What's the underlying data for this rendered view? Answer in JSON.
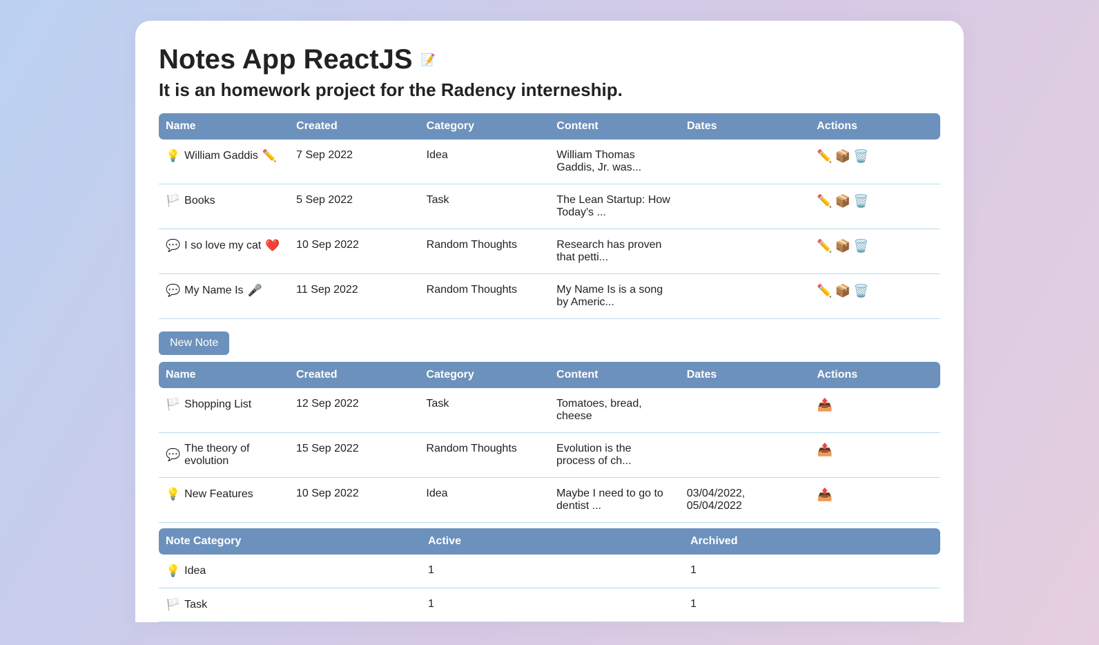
{
  "header": {
    "title": "Notes App ReactJS",
    "title_icon": "📝",
    "subtitle": "It is an homework project for the Radency interneship."
  },
  "notes_table": {
    "headers": {
      "name": "Name",
      "created": "Created",
      "category": "Category",
      "content": "Content",
      "dates": "Dates",
      "actions": "Actions"
    },
    "rows": [
      {
        "icon": "💡",
        "name": "William Gaddis",
        "name_suffix_icon": "✏️",
        "created": "7 Sep 2022",
        "category": "Idea",
        "content": "William Thomas Gaddis, Jr. was...",
        "dates": ""
      },
      {
        "icon": "🏳️",
        "name": "Books",
        "name_suffix_icon": "",
        "created": "5 Sep 2022",
        "category": "Task",
        "content": "The Lean Startup: How Today's ...",
        "dates": ""
      },
      {
        "icon": "💬",
        "name": "I so love my cat",
        "name_suffix_icon": "❤️",
        "created": "10 Sep 2022",
        "category": "Random Thoughts",
        "content": "Research has proven that petti...",
        "dates": ""
      },
      {
        "icon": "💬",
        "name": "My Name Is",
        "name_suffix_icon": "🎤",
        "created": "11 Sep 2022",
        "category": "Random Thoughts",
        "content": "My Name Is is a song by Americ...",
        "dates": ""
      }
    ],
    "action_icons": {
      "edit": "✏️",
      "archive": "📦",
      "delete": "🗑️"
    }
  },
  "new_note_button": "New Note",
  "archived_table": {
    "headers": {
      "name": "Name",
      "created": "Created",
      "category": "Category",
      "content": "Content",
      "dates": "Dates",
      "actions": "Actions"
    },
    "rows": [
      {
        "icon": "🏳️",
        "name": "Shopping List",
        "created": "12 Sep 2022",
        "category": "Task",
        "content": "Tomatoes, bread, cheese",
        "dates": ""
      },
      {
        "icon": "💬",
        "name": "The theory of evolution",
        "created": "15 Sep 2022",
        "category": "Random Thoughts",
        "content": "Evolution is the process of ch...",
        "dates": ""
      },
      {
        "icon": "💡",
        "name": "New Features",
        "created": "10 Sep 2022",
        "category": "Idea",
        "content": "Maybe I need to go to dentist ...",
        "dates": "03/04/2022, 05/04/2022"
      }
    ],
    "action_icons": {
      "unarchive": "📤"
    }
  },
  "summary_table": {
    "headers": {
      "category": "Note Category",
      "active": "Active",
      "archived": "Archived"
    },
    "rows": [
      {
        "icon": "💡",
        "category": "Idea",
        "active": "1",
        "archived": "1"
      },
      {
        "icon": "🏳️",
        "category": "Task",
        "active": "1",
        "archived": "1"
      }
    ]
  }
}
